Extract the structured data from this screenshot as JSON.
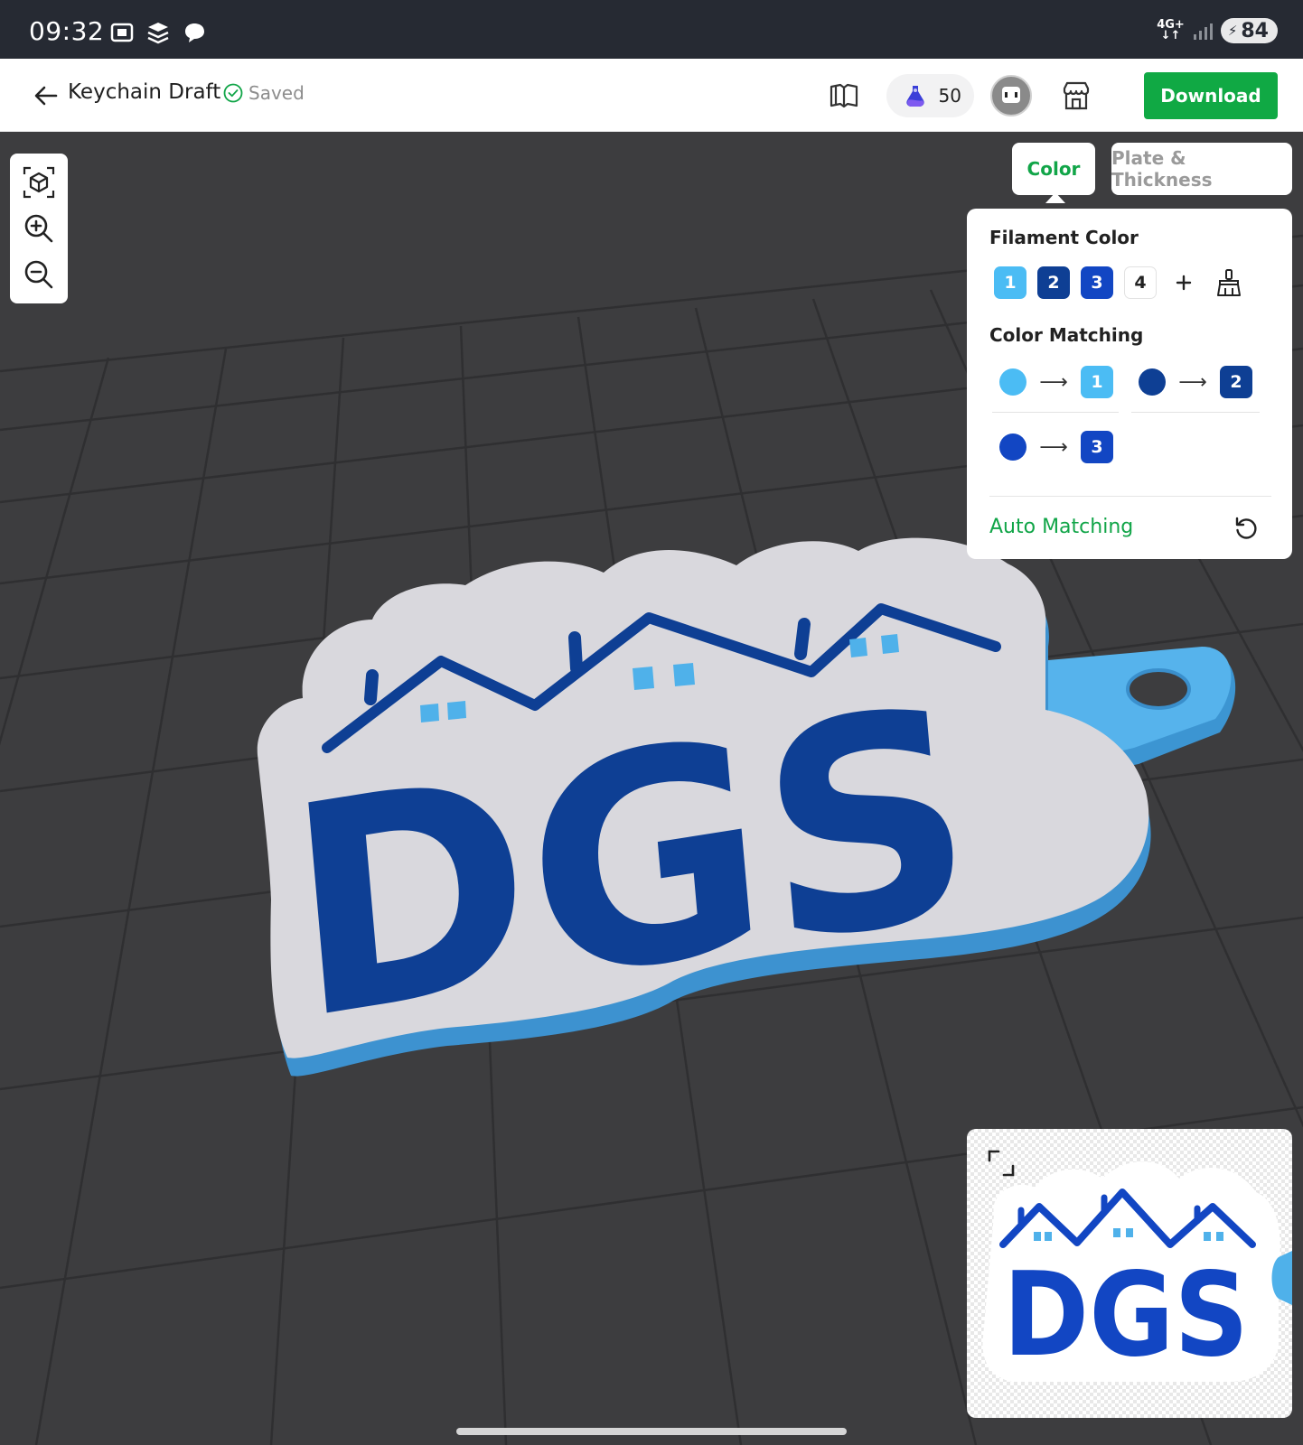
{
  "status_bar": {
    "time": "09:32",
    "network": "4G+",
    "battery": "84"
  },
  "header": {
    "title": "Keychain Draft",
    "saved_label": "Saved",
    "credits": "50",
    "download_label": "Download"
  },
  "tabs": [
    {
      "label": "Color",
      "active": true
    },
    {
      "label": "Plate & Thickness",
      "active": false
    }
  ],
  "color_panel": {
    "filament_heading": "Filament Color",
    "filaments": [
      {
        "label": "1",
        "color": "#4bbcf4"
      },
      {
        "label": "2",
        "color": "#0e3f94"
      },
      {
        "label": "3",
        "color": "#1246c3"
      },
      {
        "label": "4",
        "color": "#ffffff"
      }
    ],
    "matching_heading": "Color Matching",
    "matches": [
      {
        "source_color": "#4bbcf4",
        "target": "1"
      },
      {
        "source_color": "#0e3f94",
        "target": "2"
      },
      {
        "source_color": "#1246c3",
        "target": "3"
      }
    ],
    "auto_matching_label": "Auto Matching"
  },
  "model": {
    "logo_text": "DGS"
  },
  "colors": {
    "accent": "#11a548",
    "status_bar": "#262a33",
    "viewport": "#3d3d3f",
    "logo_blue": "#0e3f94",
    "window_blue": "#4fb1ea",
    "plate_white": "#d9d8dd"
  }
}
